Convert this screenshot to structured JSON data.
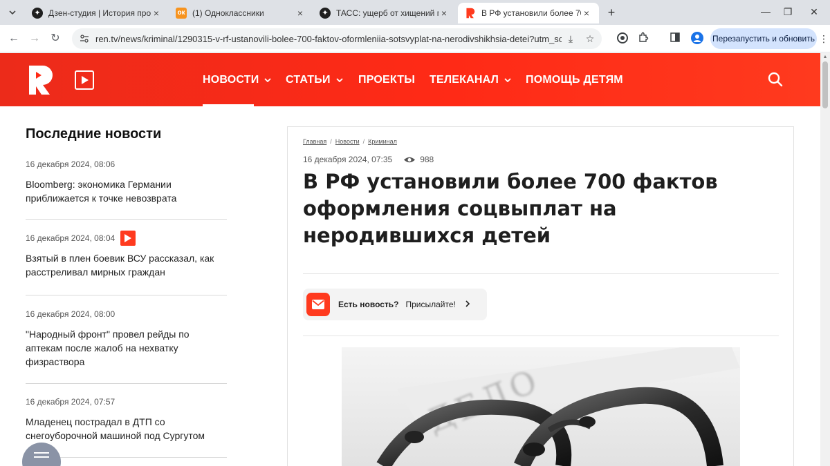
{
  "browser": {
    "tabs": [
      {
        "title": "Дзен-студия | История про од",
        "active": false
      },
      {
        "title": "(1) Одноклассники",
        "active": false
      },
      {
        "title": "ТАСС: ущерб от хищений мате",
        "active": false
      },
      {
        "title": "В РФ установили более 700 ф",
        "active": true
      }
    ],
    "url": "ren.tv/news/kriminal/1290315-v-rf-ustanovili-bolee-700-faktov-oformleniia-sotsvyplat-na-nerodivshikhsia-detei?utm_sour...",
    "relaunch_label": "Перезапустить и обновить",
    "accent": "#d3e3fd"
  },
  "site": {
    "brand_color": "#ff2a16",
    "menu": [
      {
        "label": "НОВОСТИ",
        "dropdown": true
      },
      {
        "label": "СТАТЬИ",
        "dropdown": true
      },
      {
        "label": "ПРОЕКТЫ",
        "dropdown": false
      },
      {
        "label": "ТЕЛЕКАНАЛ",
        "dropdown": true
      },
      {
        "label": "ПОМОЩЬ ДЕТЯМ",
        "dropdown": false
      }
    ],
    "active_menu": "НОВОСТИ"
  },
  "sidebar": {
    "title": "Последние новости",
    "items": [
      {
        "date": "16 декабря 2024, 08:06",
        "text": "Bloomberg: экономика Германии приближается к точке невозврата",
        "video": false
      },
      {
        "date": "16 декабря 2024, 08:04",
        "text": "Взятый в плен боевик ВСУ рассказал, как расстреливал мирных граждан",
        "video": true
      },
      {
        "date": "16 декабря 2024, 08:00",
        "text": "\"Народный фронт\" провел рейды по аптекам после жалоб на нехватку физраствора",
        "video": false
      },
      {
        "date": "16 декабря 2024, 07:57",
        "text": "Младенец пострадал в ДТП со снегоуборочной машиной под Сургутом",
        "video": false
      }
    ]
  },
  "article": {
    "breadcrumbs": [
      "Главная",
      "Новости",
      "Криминал"
    ],
    "date": "16 декабря 2024, 07:35",
    "views": "988",
    "title": "В РФ установили более 700 фактов оформления соцвыплат на неродившихся детей",
    "tip": {
      "question": "Есть новость?",
      "action": "Присылайте!"
    },
    "photo_alt_text": "ДЕЛО"
  }
}
